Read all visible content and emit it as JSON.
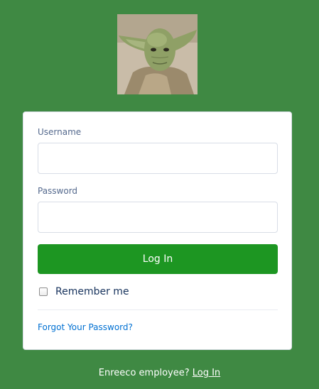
{
  "logo": {
    "icon": "yoda-portrait",
    "colors": {
      "background": "#c9bca8",
      "skin": "#8fa066",
      "robe": "#9b8a6c"
    }
  },
  "form": {
    "username_label": "Username",
    "username_value": "",
    "password_label": "Password",
    "password_value": "",
    "login_label": "Log In",
    "remember_label": "Remember me",
    "remember_checked": false,
    "forgot_label": "Forgot Your Password?"
  },
  "footer": {
    "prompt": "Enreeco employee?",
    "link_label": "Log In"
  },
  "colors": {
    "page_background": "#3f8943",
    "button": "#1d9622",
    "link": "#0070d2",
    "label": "#54698d"
  }
}
